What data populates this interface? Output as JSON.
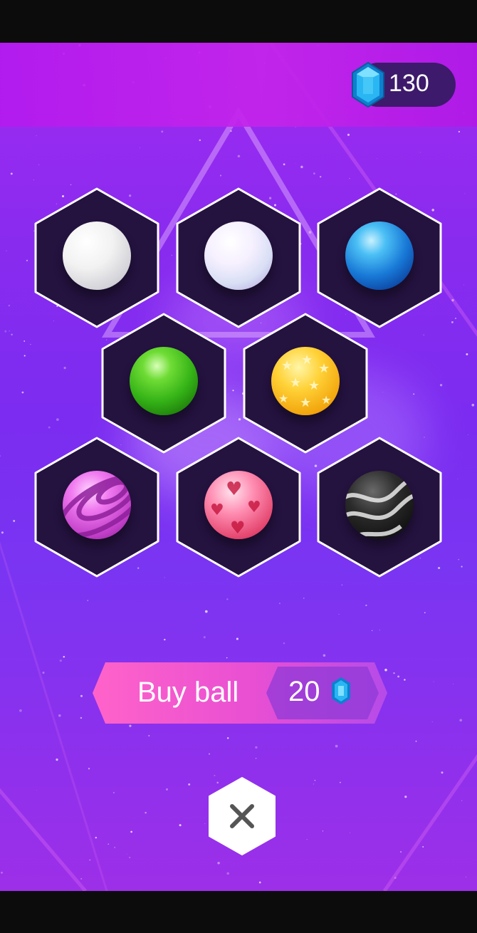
{
  "currency": {
    "gems": "130",
    "icon": "blue-gem-icon",
    "gem_color": "#1fa8e0"
  },
  "balls": [
    {
      "name": "white-ball",
      "style": "white"
    },
    {
      "name": "pearl-ball",
      "style": "pearl"
    },
    {
      "name": "blue-ball",
      "style": "blue"
    },
    {
      "name": "green-ball",
      "style": "green"
    },
    {
      "name": "star-ball",
      "style": "stars"
    },
    {
      "name": "purple-striped-ball",
      "style": "stripes"
    },
    {
      "name": "heart-ball",
      "style": "hearts"
    },
    {
      "name": "black-swirl-ball",
      "style": "swirl"
    }
  ],
  "buy": {
    "label": "Buy ball",
    "price": "20",
    "accent": "#ff67d6"
  },
  "close": {
    "icon": "close-icon"
  },
  "colors": {
    "hex_fill": "#24123f",
    "hex_border": "#ffffff"
  }
}
